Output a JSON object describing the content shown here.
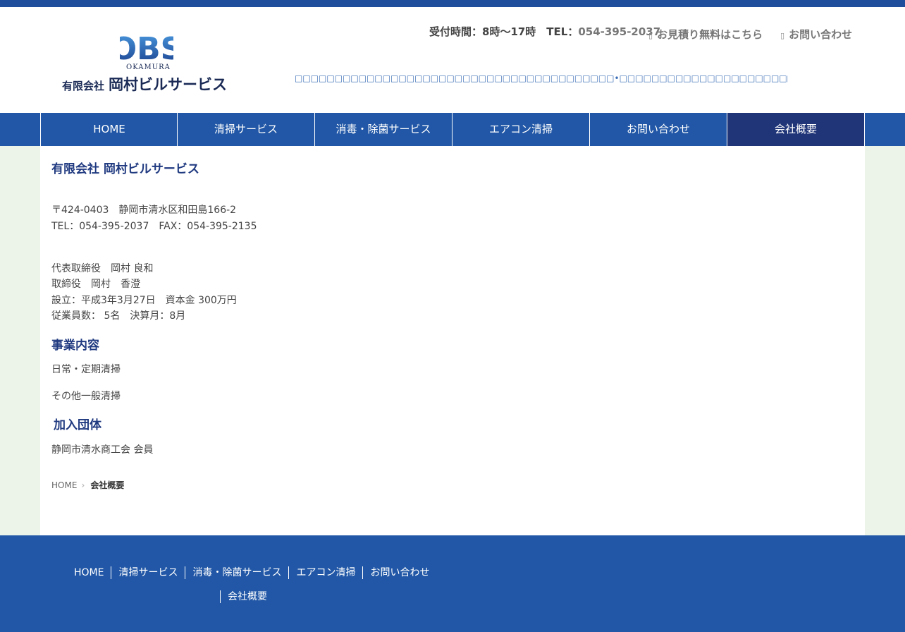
{
  "colors": {
    "brand_blue": "#2157a6",
    "active_nav": "#203578",
    "heading": "#203a80",
    "page_bg": "#ecf4ea"
  },
  "header": {
    "logo": {
      "mark": "OBS",
      "sub": "OKAMURA",
      "kabushiki": "有限会社",
      "company": "岡村ビルサービス"
    },
    "hours": "受付時間：8時〜17時　TEL：",
    "tel": "054-395-2037",
    "links": [
      {
        "icon": "document-icon",
        "label": "お見積り無料はこちら"
      },
      {
        "icon": "mail-icon",
        "label": "お問い合わせ"
      }
    ],
    "tagline": "□□□□□□□□□□□□□□□□□□□□□□□□□□□□□□□□□□□□□□□□•□□□□□□□□□□□□□□□□□□□□□□□□□□□□□□□□□□□□□□□□□□□□□□□□□□□□□□□□□□□□□□□□□□□□□□□□□□□□□□□□□□□□□□□□•□□□□□□□□□□□□□□□□□□□□□□□□□□□□□□□"
  },
  "nav": {
    "items": [
      {
        "label": "HOME",
        "active": false
      },
      {
        "label": "清掃サービス",
        "active": false
      },
      {
        "label": "消毒・除菌サービス",
        "active": false
      },
      {
        "label": "エアコン清掃",
        "active": false
      },
      {
        "label": "お問い合わせ",
        "active": false
      },
      {
        "label": "会社概要",
        "active": true
      }
    ]
  },
  "main": {
    "company_title": "有限会社 岡村ビルサービス",
    "address": "〒424-0403　静岡市清水区和田島166-2",
    "tel_fax": "TEL：054-395-2037　FAX：054-395-2135",
    "rep": "代表取締役　岡村 良和",
    "director": "取締役　岡村　香澄",
    "founded": "設立：平成3年3月27日　資本金 300万円",
    "staff": "従業員数： 5名　決算月：8月",
    "business_title": "事業内容",
    "business_items": [
      "日常・定期清掃",
      "その他一般清掃"
    ],
    "membership_title": "加入団体",
    "membership": "静岡市清水商工会 会員",
    "breadcrumb": {
      "home": "HOME",
      "current": "会社概要"
    }
  },
  "footer": {
    "links": [
      "HOME",
      "清掃サービス",
      "消毒・除菌サービス",
      "エアコン清掃",
      "お問い合わせ"
    ],
    "link_2nd": "会社概要"
  }
}
